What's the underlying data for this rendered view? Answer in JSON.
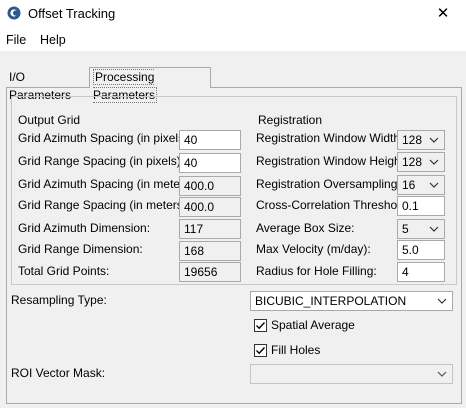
{
  "window": {
    "title": "Offset Tracking",
    "icon": "snap-app-icon",
    "close_glyph": "✕"
  },
  "menu": [
    {
      "label": "File"
    },
    {
      "label": "Help"
    }
  ],
  "tabs": [
    {
      "label": "I/O Parameters",
      "selected": false
    },
    {
      "label": "Processing Parameters",
      "selected": true
    }
  ],
  "output_grid": {
    "title": "Output Grid",
    "rows": [
      {
        "label": "Grid Azimuth Spacing (in pixels):",
        "value": "40",
        "editable": true
      },
      {
        "label": "Grid Range Spacing (in pixels):",
        "value": "40",
        "editable": true
      },
      {
        "label": "Grid Azimuth Spacing (in meters):",
        "value": "400.0",
        "editable": false
      },
      {
        "label": "Grid Range Spacing (in meters):",
        "value": "400.0",
        "editable": false
      },
      {
        "label": "Grid Azimuth Dimension:",
        "value": "117",
        "editable": false
      },
      {
        "label": "Grid Range Dimension:",
        "value": "168",
        "editable": false
      },
      {
        "label": "Total Grid Points:",
        "value": "19656",
        "editable": false
      }
    ]
  },
  "registration": {
    "title": "Registration",
    "rows": [
      {
        "label": "Registration Window Width:",
        "value": "128",
        "type": "select"
      },
      {
        "label": "Registration Window Height:",
        "value": "128",
        "type": "select"
      },
      {
        "label": "Registration Oversampling:",
        "value": "16",
        "type": "select"
      },
      {
        "label": "Cross-Correlation Threshold:",
        "value": "0.1",
        "type": "input"
      },
      {
        "label": "Average Box Size:",
        "value": "5",
        "type": "select"
      },
      {
        "label": "Max Velocity (m/day):",
        "value": "5.0",
        "type": "input"
      },
      {
        "label": "Radius for Hole Filling:",
        "value": "4",
        "type": "input"
      }
    ]
  },
  "resampling": {
    "label": "Resampling Type:",
    "value": "BICUBIC_INTERPOLATION"
  },
  "spatial_average": {
    "label": "Spatial Average",
    "checked": true
  },
  "fill_holes": {
    "label": "Fill Holes",
    "checked": true
  },
  "roi_mask": {
    "label": "ROI Vector Mask:",
    "value": ""
  }
}
